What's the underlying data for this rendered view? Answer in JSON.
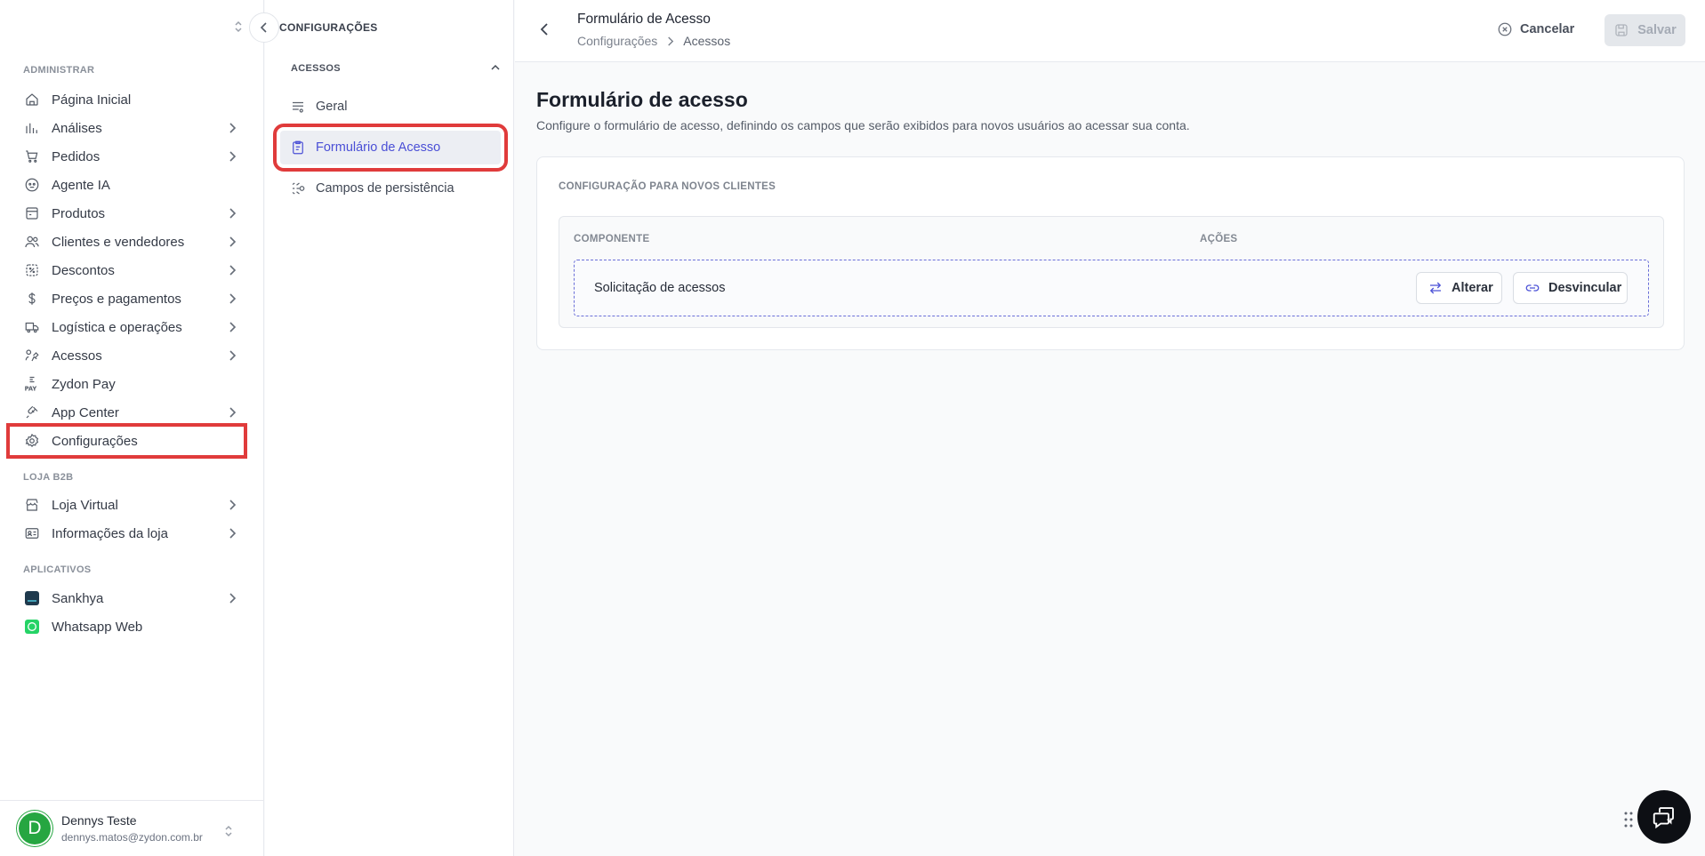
{
  "sidebar": {
    "sections": {
      "admin": "ADMINISTRAR",
      "store": "LOJA B2B",
      "apps": "APLICATIVOS"
    },
    "items": [
      {
        "label": "Página Inicial",
        "icon": "home-icon"
      },
      {
        "label": "Análises",
        "icon": "chart-icon"
      },
      {
        "label": "Pedidos",
        "icon": "cart-icon"
      },
      {
        "label": "Agente IA",
        "icon": "robot-icon"
      },
      {
        "label": "Produtos",
        "icon": "box-icon"
      },
      {
        "label": "Clientes e vendedores",
        "icon": "users-icon"
      },
      {
        "label": "Descontos",
        "icon": "discount-icon"
      },
      {
        "label": "Preços e pagamentos",
        "icon": "dollar-icon"
      },
      {
        "label": "Logística e operações",
        "icon": "truck-icon"
      },
      {
        "label": "Acessos",
        "icon": "access-icon"
      },
      {
        "label": "Zydon Pay",
        "icon": "pay-icon"
      },
      {
        "label": "App Center",
        "icon": "plug-icon"
      },
      {
        "label": "Configurações",
        "icon": "gear-icon"
      }
    ],
    "store_items": [
      {
        "label": "Loja Virtual",
        "icon": "store-icon"
      },
      {
        "label": "Informações da loja",
        "icon": "id-card-icon"
      }
    ],
    "app_items": [
      {
        "label": "Sankhya",
        "icon": "sankhya-icon"
      },
      {
        "label": "Whatsapp Web",
        "icon": "whatsapp-icon"
      }
    ],
    "user": {
      "initial": "D",
      "name": "Dennys Teste",
      "email": "dennys.matos@zydon.com.br"
    }
  },
  "panel": {
    "title": "CONFIGURAÇÕES",
    "group": "ACESSOS",
    "items": [
      {
        "label": "Geral",
        "icon": "sliders-icon"
      },
      {
        "label": "Formulário de Acesso",
        "icon": "clipboard-icon"
      },
      {
        "label": "Campos de persistência",
        "icon": "fields-icon"
      }
    ]
  },
  "header": {
    "title": "Formulário de Acesso",
    "breadcrumb": [
      "Configurações",
      "Acessos"
    ],
    "cancel_label": "Cancelar",
    "save_label": "Salvar"
  },
  "main": {
    "title": "Formulário de acesso",
    "description": "Configure o formulário de acesso, definindo os campos que serão exibidos para novos usuários ao acessar sua conta.",
    "card_title": "CONFIGURAÇÃO PARA NOVOS CLIENTES",
    "columns": [
      "COMPONENTE",
      "AÇÕES"
    ],
    "rows": [
      {
        "component": "Solicitação de acessos",
        "alter_label": "Alterar",
        "unlink_label": "Desvincular"
      }
    ]
  },
  "colors": {
    "accent": "#4a4fd6",
    "highlight": "#e03b3b",
    "avatar": "#26a641"
  }
}
